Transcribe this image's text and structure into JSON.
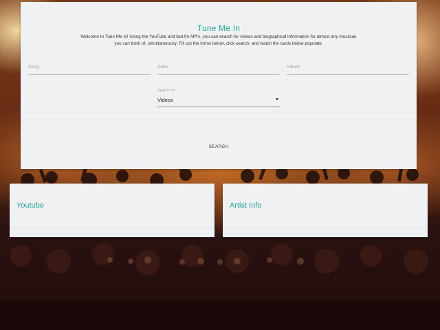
{
  "main": {
    "title": "Tune Me In",
    "intro_line1": "Welcome to Tune Me In! Using the YouTube and last.fm API's, you can search for videos and biographical information for almost any musician",
    "intro_line2": "you can think of, simultaneously. Fill out the forms below, click search, and watch the cards below populate.",
    "fields": {
      "song_placeholder": "Song:",
      "artist_placeholder": "Artist:",
      "album_placeholder": "Album:"
    },
    "select": {
      "label": "Search for:",
      "value": "Videos"
    },
    "search_label": "SEARCH"
  },
  "cards": {
    "youtube_title": "Youtube",
    "artist_title": "Artist Info"
  },
  "colors": {
    "accent": "#26a69a",
    "card_bg": "#f0f1f2"
  }
}
